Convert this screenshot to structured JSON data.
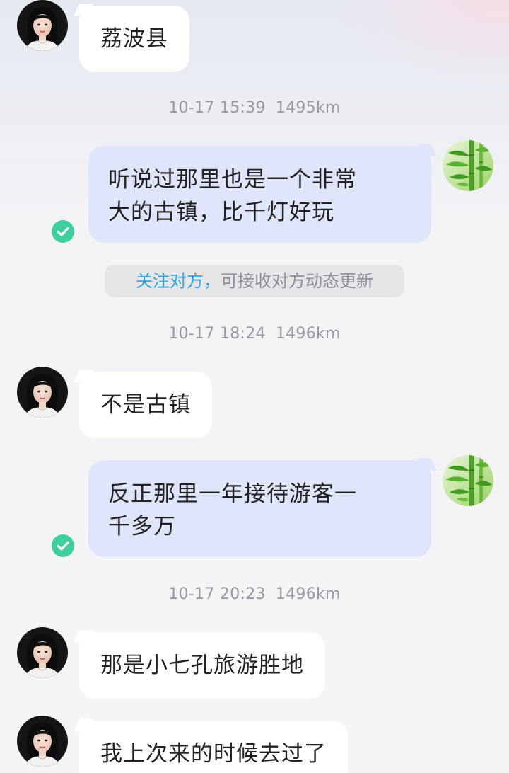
{
  "messages": [
    {
      "side": "left",
      "text": "荔波县"
    },
    {
      "side": "meta",
      "time": "10-17 15:39",
      "distance": "1495km"
    },
    {
      "side": "right",
      "line1": "听说过那里也是一个非常",
      "line2": "大的古镇，比千灯好玩"
    },
    {
      "side": "left",
      "text": "不是古镇"
    },
    {
      "side": "meta",
      "time": "10-17 18:24",
      "distance": "1496km"
    },
    {
      "side": "right",
      "line1": "反正那里一年接待游客一",
      "line2": "千多万"
    },
    {
      "side": "meta",
      "time": "10-17 20:23",
      "distance": "1496km"
    },
    {
      "side": "left",
      "text": "那是小七孔旅游胜地"
    },
    {
      "side": "left",
      "text": "我上次来的时候去过了"
    }
  ],
  "follow_hint": {
    "link": "关注对方，",
    "text": "可接收对方动态更新"
  },
  "colors": {
    "self_bubble": "#dfe5fb",
    "other_bubble": "#ffffff",
    "link": "#2aa6e0",
    "read_check": "#3fcf9f"
  },
  "icons": {
    "read_receipt": "check-circle-icon",
    "self_avatar": "bamboo-avatar",
    "contact_avatar": "woman-avatar"
  }
}
